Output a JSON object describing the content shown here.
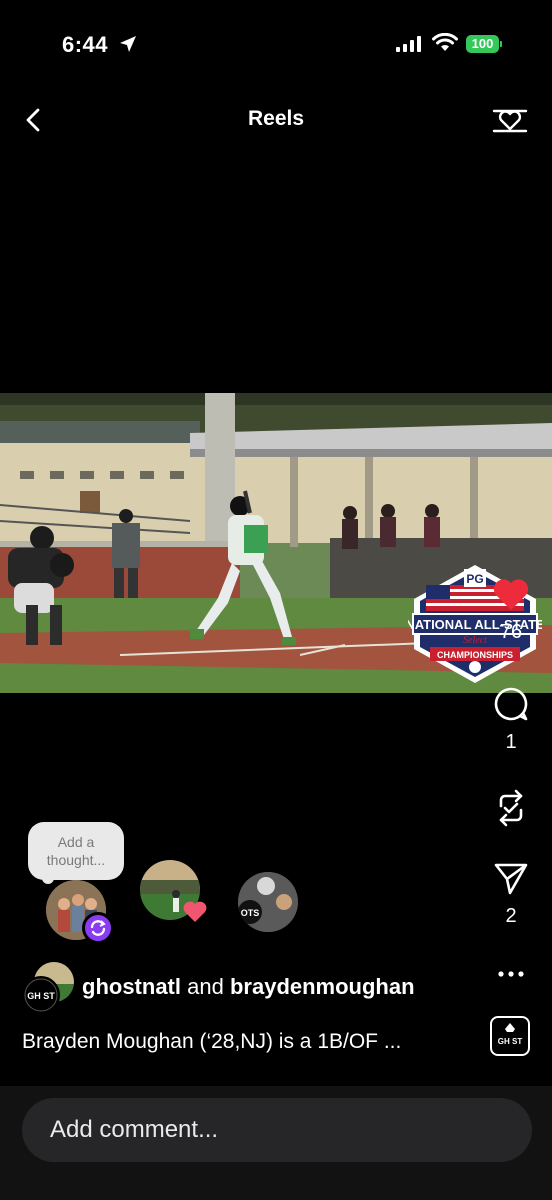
{
  "status": {
    "time": "6:44",
    "battery": "100"
  },
  "header": {
    "title": "Reels"
  },
  "video": {
    "logo_title": "NATIONAL ALL-STATE",
    "logo_sub": "Select",
    "logo_bottom": "CHAMPIONSHIPS",
    "logo_mark": "PG"
  },
  "actions": {
    "likes": "76",
    "comments": "1",
    "reposts": "",
    "shares": "2"
  },
  "thought_bubble": {
    "text": "Add a thought..."
  },
  "avatars": {
    "third_label": "OTS"
  },
  "post": {
    "author1": "ghostnatl",
    "joiner": "and",
    "author2": "braydenmoughan",
    "caption": "Brayden Moughan (‘28,NJ) is a 1B/OF ...",
    "badge_text": "GH ST"
  },
  "comment": {
    "placeholder": "Add comment..."
  },
  "colors": {
    "heart": "#ed2b3a",
    "battery": "#34c759",
    "repost_badge": "#8a3cf2"
  }
}
